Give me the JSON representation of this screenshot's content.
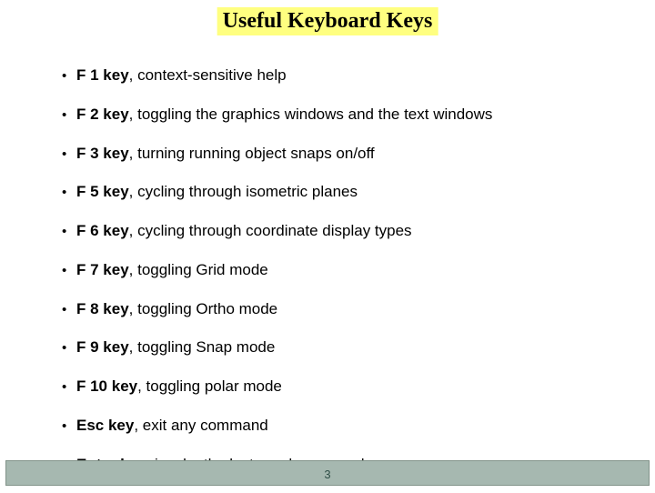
{
  "title": "Useful Keyboard Keys",
  "page_number": "3",
  "items": [
    {
      "key": "F 1 key",
      "desc": ", context-sensitive help"
    },
    {
      "key": "F 2 key",
      "desc": ", toggling the graphics windows and the text windows"
    },
    {
      "key": "F 3 key",
      "desc": ", turning running object snaps on/off"
    },
    {
      "key": "F 5 key",
      "desc": ", cycling through isometric planes"
    },
    {
      "key": "F 6 key",
      "desc": ", cycling through coordinate display types"
    },
    {
      "key": "F 7 key",
      "desc": ", toggling Grid mode"
    },
    {
      "key": "F 8 key",
      "desc": ", toggling Ortho mode"
    },
    {
      "key": "F 9 key",
      "desc": ", toggling Snap mode"
    },
    {
      "key": "F 10 key",
      "desc": ", toggling polar mode"
    },
    {
      "key": "Esc key",
      "desc": ", exit any command"
    },
    {
      "key": "Enter key",
      "desc": ", invoke the last-used command"
    }
  ]
}
